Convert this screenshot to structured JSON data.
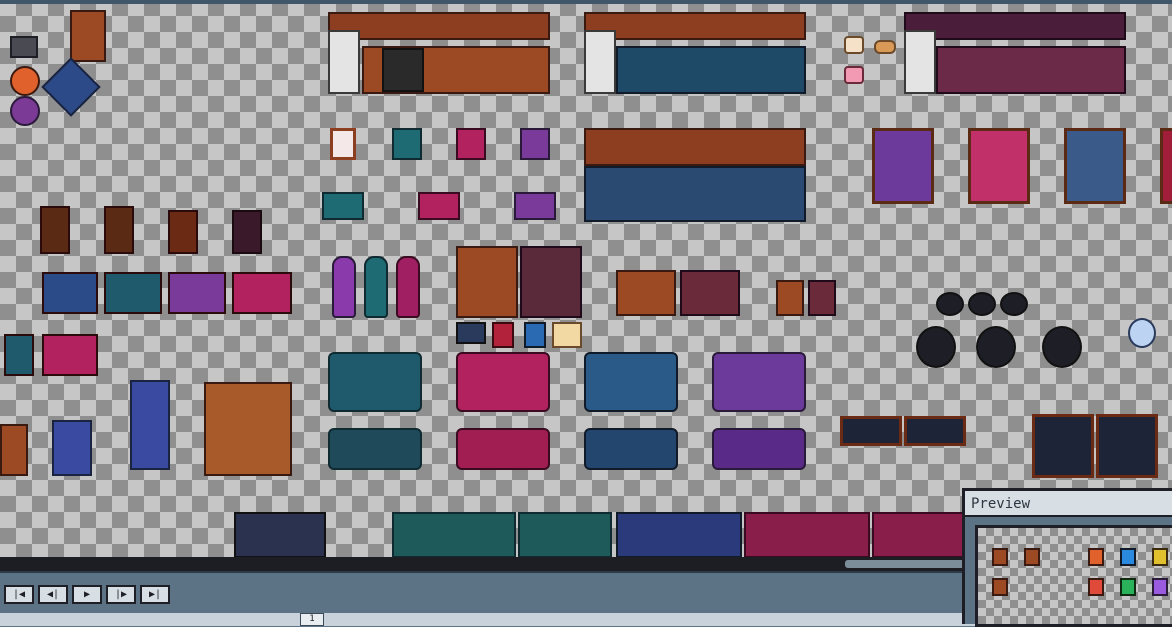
{
  "preview": {
    "title": "Preview"
  },
  "timeline": {
    "controls": {
      "first": "|◀",
      "prev": "◀|",
      "play": "▶",
      "next": "|▶",
      "last": "▶|"
    },
    "current_frame": "1"
  },
  "colors": {
    "checker_light": "#c6c6c6",
    "checker_dark": "#8f8f8f",
    "wood": "#9b4a24",
    "teal": "#1e6b73",
    "magenta": "#b2225f",
    "purple": "#6b3a9a",
    "navy": "#2a3a5c",
    "panel": "#5c7386"
  },
  "sprite_groups": [
    "kitchen-counters",
    "windows",
    "curtains",
    "chairs",
    "bookshelves",
    "books",
    "floor-lamps",
    "desks",
    "stools",
    "sofas",
    "beds",
    "cauldrons",
    "crystal-ball",
    "constellation-paintings",
    "rugs",
    "magic-carpets"
  ]
}
